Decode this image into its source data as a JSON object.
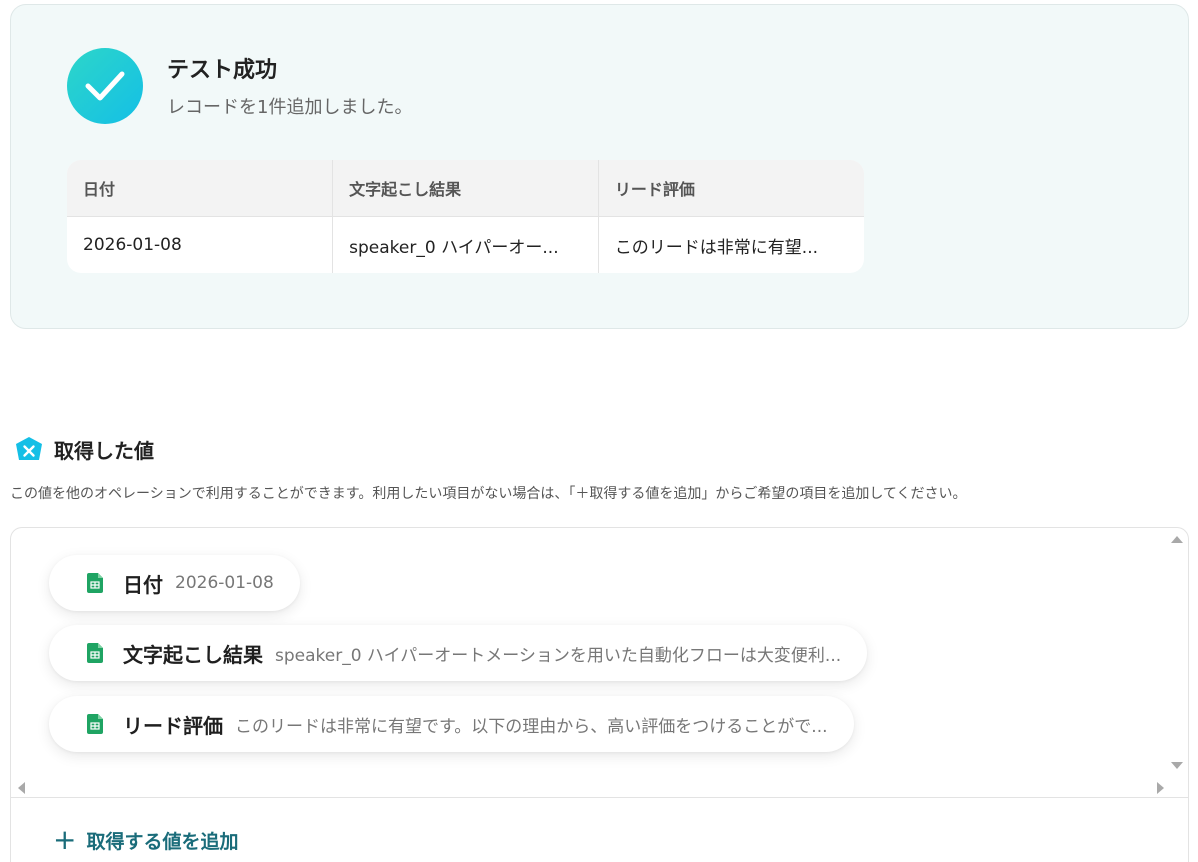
{
  "success": {
    "title": "テスト成功",
    "subtitle": "レコードを1件追加しました。"
  },
  "result_table": {
    "headers": [
      "日付",
      "文字起こし結果",
      "リード評価"
    ],
    "rows": [
      [
        "2026-01-08",
        "speaker_0 ハイパーオー...",
        "このリードは非常に有望..."
      ]
    ]
  },
  "section": {
    "title": "取得した値",
    "description": "この値を他のオペレーションで利用することができます。利用したい項目がない場合は、「＋取得する値を追加」からご希望の項目を追加してください。"
  },
  "values": [
    {
      "label": "日付",
      "value": "2026-01-08"
    },
    {
      "label": "文字起こし結果",
      "value": "speaker_0 ハイパーオートメーションを用いた自動化フローは大変便利..."
    },
    {
      "label": "リード評価",
      "value": "このリードは非常に有望です。以下の理由から、高い評価をつけることがで..."
    }
  ],
  "add_button": {
    "label": "取得する値を追加",
    "icon": "+"
  },
  "colors": {
    "accent": "#1a6c7a",
    "success_gradient_start": "#2dd6c9",
    "success_gradient_end": "#14bfe6",
    "sheet_green": "#1fa463"
  }
}
